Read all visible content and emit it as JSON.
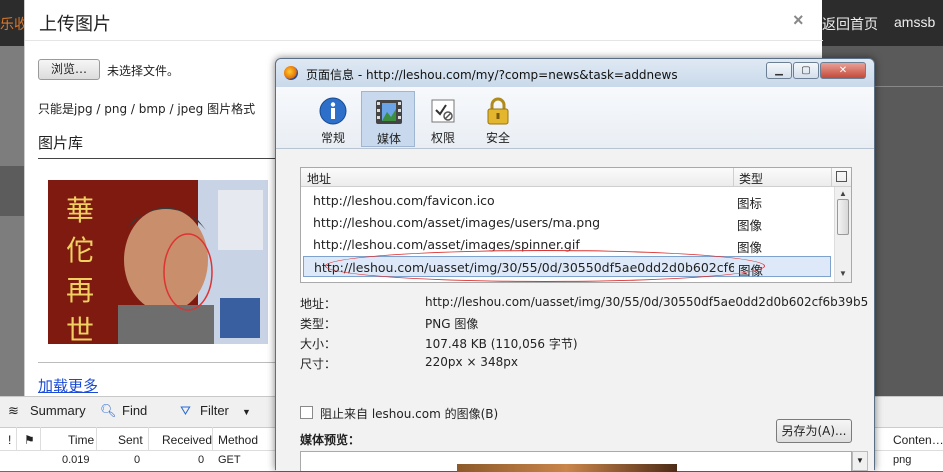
{
  "background": {
    "top_left_text": "乐收",
    "back_home": "返回首页",
    "username": "amssb"
  },
  "upload_dialog": {
    "title": "上传图片",
    "close": "×",
    "browse_label": "浏览…",
    "no_file": "未选择文件。",
    "format_hint": "只能是jpg / png / bmp / jpeg 图片格式",
    "library_title": "图片库",
    "load_more": "加载更多",
    "photo_text": "華佗再世"
  },
  "devtools": {
    "toolbar": {
      "summary": "Summary",
      "find": "Find",
      "filter": "Filter"
    },
    "columns": {
      "flag1": "!",
      "flag2": "",
      "time": "Time",
      "sent": "Sent",
      "received": "Received",
      "method": "Method",
      "content": "Conten…"
    },
    "row": {
      "time": "0.019",
      "sent": "0",
      "received": "0",
      "method": "GET",
      "content": "png"
    }
  },
  "page_info": {
    "window_title": "页面信息 - http://leshou.com/my/?comp=news&task=addnews",
    "buttons": {
      "minimize": "▁",
      "maximize": "▢",
      "close": "✕"
    },
    "tabs": [
      {
        "label": "常规",
        "icon": "info-icon"
      },
      {
        "label": "媒体",
        "icon": "media-icon"
      },
      {
        "label": "权限",
        "icon": "permissions-icon"
      },
      {
        "label": "安全",
        "icon": "lock-icon"
      }
    ],
    "selected_tab": "媒体",
    "media_list": {
      "header_address": "地址",
      "header_type": "类型",
      "rows": [
        {
          "url": "http://leshou.com/favicon.ico",
          "type": "图标"
        },
        {
          "url": "http://leshou.com/asset/images/users/ma.png",
          "type": "图像"
        },
        {
          "url": "http://leshou.com/asset/images/spinner.gif",
          "type": "图像"
        },
        {
          "url": "http://leshou.com/uasset/img/30/55/0d/30550df5ae0dd2d0b602cf6b3...",
          "type": "图像"
        }
      ],
      "selected_row": 3
    },
    "properties": [
      {
        "key": "地址：",
        "value": "http://leshou.com/uasset/img/30/55/0d/30550df5ae0dd2d0b602cf6b39b5"
      },
      {
        "key": "类型：",
        "value": "PNG 图像"
      },
      {
        "key": "大小：",
        "value": "107.48 KB (110,056 字节)"
      },
      {
        "key": "尺寸：",
        "value": "220px × 348px"
      }
    ],
    "block_images_label": "阻止来自 leshou.com 的图像(B)",
    "save_as_label": "另存为(A)...",
    "preview_label": "媒体预览："
  },
  "colors": {
    "highlight_ellipse": "#dd3333",
    "link_blue": "#1a4ad6",
    "selection_bg": "#dde9f8"
  }
}
